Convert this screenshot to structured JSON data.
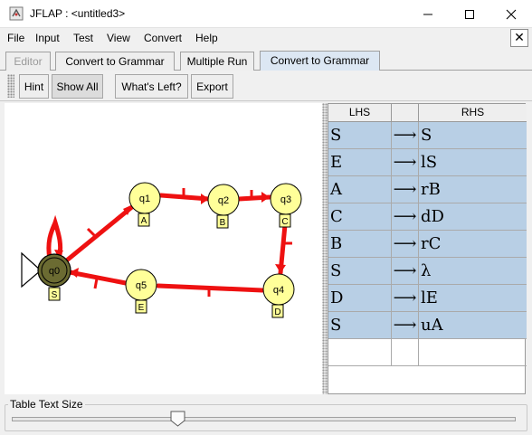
{
  "window": {
    "title": "JFLAP : <untitled3>",
    "app_icon": "jflap-app-icon",
    "controls": [
      "minimize-icon",
      "maximize-icon",
      "close-icon"
    ]
  },
  "menu": {
    "items": [
      "File",
      "Input",
      "Test",
      "View",
      "Convert",
      "Help"
    ],
    "close_symbol": "✕"
  },
  "tabs": [
    {
      "label": "Editor",
      "state": "disabled"
    },
    {
      "label": "Convert to Grammar",
      "state": "normal"
    },
    {
      "label": "Multiple Run",
      "state": "normal"
    },
    {
      "label": "Convert to Grammar",
      "state": "selected"
    }
  ],
  "toolbar": {
    "hint": "Hint",
    "show_all": "Show All",
    "whats_left": "What's Left?",
    "export": "Export"
  },
  "automaton": {
    "initial_state": "q0",
    "final_states": [
      "q0"
    ],
    "states": [
      {
        "name": "q0",
        "variable": "S",
        "highlighted": true
      },
      {
        "name": "q1",
        "variable": "A"
      },
      {
        "name": "q2",
        "variable": "B"
      },
      {
        "name": "q3",
        "variable": "C"
      },
      {
        "name": "q4",
        "variable": "D"
      },
      {
        "name": "q5",
        "variable": "E"
      }
    ],
    "transitions": [
      {
        "from": "q0",
        "to": "q0"
      },
      {
        "from": "q0",
        "to": "q1"
      },
      {
        "from": "q1",
        "to": "q2"
      },
      {
        "from": "q2",
        "to": "q3"
      },
      {
        "from": "q3",
        "to": "q4"
      },
      {
        "from": "q4",
        "to": "q5"
      },
      {
        "from": "q5",
        "to": "q0"
      }
    ],
    "transition_color": "#ee1111",
    "state_fill": "#ffff99",
    "highlight_fill": "#6b6b32"
  },
  "grammar_table": {
    "columns": [
      "LHS",
      "",
      "RHS"
    ],
    "arrow": "⟶",
    "rows": [
      {
        "lhs": "S",
        "rhs": "S"
      },
      {
        "lhs": "E",
        "rhs": "lS"
      },
      {
        "lhs": "A",
        "rhs": "rB"
      },
      {
        "lhs": "C",
        "rhs": "dD"
      },
      {
        "lhs": "B",
        "rhs": "rC"
      },
      {
        "lhs": "S",
        "rhs": "λ"
      },
      {
        "lhs": "D",
        "rhs": "lE"
      },
      {
        "lhs": "S",
        "rhs": "uA"
      },
      {
        "lhs": "",
        "rhs": ""
      }
    ],
    "row_highlight": "#b8cfe5"
  },
  "table_text_size": {
    "label": "Table Text Size",
    "value_fraction": 0.33
  }
}
